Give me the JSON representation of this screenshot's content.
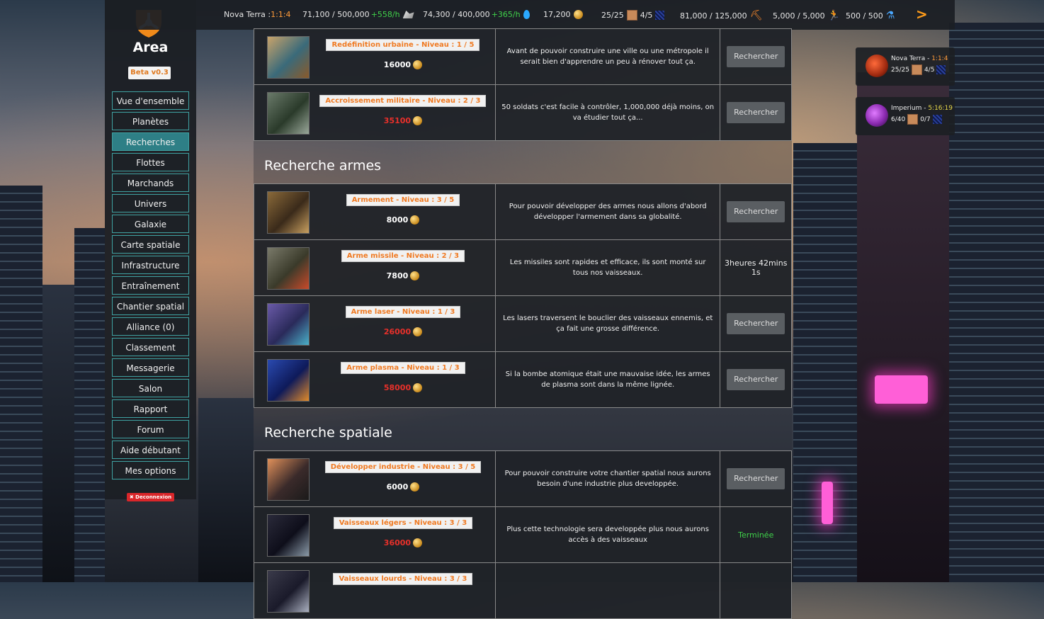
{
  "topbar": {
    "planet_name": "Nova Terra : ",
    "planet_pos": "1:1:4",
    "metal": "71,100 / 500,000",
    "metal_rate": "+558/h",
    "water": "74,300 / 400,000",
    "water_rate": "+365/h",
    "credits": "17,200",
    "fields": "25/25",
    "slots": "4/5",
    "energy": "81,000 / 125,000",
    "population": "5,000 / 5,000",
    "research_pts": "500 / 500",
    "next_label": ">"
  },
  "sidebar": {
    "logo_text": "Area",
    "version": "Beta v0.3",
    "items": [
      {
        "label": "Vue d'ensemble",
        "name": "sidebar-item-overview"
      },
      {
        "label": "Planètes",
        "name": "sidebar-item-planets"
      },
      {
        "label": "Recherches",
        "name": "sidebar-item-research"
      },
      {
        "label": "Flottes",
        "name": "sidebar-item-fleets"
      },
      {
        "label": "Marchands",
        "name": "sidebar-item-merchants"
      },
      {
        "label": "Univers",
        "name": "sidebar-item-universe"
      },
      {
        "label": "Galaxie",
        "name": "sidebar-item-galaxy"
      },
      {
        "label": "Carte spatiale",
        "name": "sidebar-item-space-map"
      },
      {
        "label": "Infrastructure",
        "name": "sidebar-item-infrastructure"
      },
      {
        "label": "Entraînement",
        "name": "sidebar-item-training"
      },
      {
        "label": "Chantier spatial",
        "name": "sidebar-item-shipyard"
      },
      {
        "label": "Alliance (0)",
        "name": "sidebar-item-alliance"
      },
      {
        "label": "Classement",
        "name": "sidebar-item-ranking"
      },
      {
        "label": "Messagerie",
        "name": "sidebar-item-messages"
      },
      {
        "label": "Salon",
        "name": "sidebar-item-chat"
      },
      {
        "label": "Rapport",
        "name": "sidebar-item-reports"
      },
      {
        "label": "Forum",
        "name": "sidebar-item-forum"
      },
      {
        "label": "Aide débutant",
        "name": "sidebar-item-help"
      },
      {
        "label": "Mes options",
        "name": "sidebar-item-options"
      }
    ],
    "active_index": 2,
    "logout_label": "✖ Deconnexion"
  },
  "planets": [
    {
      "name": "Nova Terra - ",
      "pos": "1:1:4",
      "fields": "25/25",
      "slots": "4/5"
    },
    {
      "name": "Imperium - ",
      "pos": "5:16:19",
      "fields": "6/40",
      "slots": "0/7"
    }
  ],
  "colors": {
    "accent": "#f07a22",
    "nav_border": "#3fa2a2",
    "nav_active": "#2e7f86",
    "cost_insufficient": "#e8302a",
    "done": "#3fd14a"
  },
  "sections": [
    {
      "title": "",
      "rows": [
        {
          "title": "Redéfinition urbaine - Niveau : 1 / 5",
          "cost": "16000",
          "affordable": true,
          "desc": "Avant de pouvoir construire une ville ou une métropole il serait bien d'apprendre un peu à rénover tout ça.",
          "action": "button",
          "action_label": "Rechercher",
          "thumb": [
            "#c9a36a",
            "#3a6a7a",
            "#8a5a2a"
          ]
        },
        {
          "title": "Accroissement militaire - Niveau : 2 / 3",
          "cost": "35100",
          "affordable": false,
          "desc": "50 soldats c'est facile à contrôler, 1,000,000 déjà moins, on va étudier tout ça...",
          "action": "button",
          "action_label": "Rechercher",
          "thumb": [
            "#6a7a6a",
            "#2a3a2a",
            "#9aa89a"
          ]
        }
      ]
    },
    {
      "title": "Recherche armes",
      "rows": [
        {
          "title": "Armement - Niveau : 3 / 5",
          "cost": "8000",
          "affordable": true,
          "desc": "Pour pouvoir développer des armes nous allons d'abord développer l'armement dans sa globalité.",
          "action": "button",
          "action_label": "Rechercher",
          "thumb": [
            "#8a6a3a",
            "#3a2a1a",
            "#c9a060"
          ]
        },
        {
          "title": "Arme missile - Niveau : 2 / 3",
          "cost": "7800",
          "affordable": true,
          "desc": "Les missiles sont rapides et efficace, ils sont monté sur tous nos vaisseaux.",
          "action": "text",
          "action_label": "3heures 42mins 1s",
          "thumb": [
            "#7a7a6a",
            "#3a3a2a",
            "#c94a2a"
          ]
        },
        {
          "title": "Arme laser - Niveau : 1 / 3",
          "cost": "26000",
          "affordable": false,
          "desc": "Les lasers traversent le bouclier des vaisseaux ennemis, et ça fait une grosse différence.",
          "action": "button",
          "action_label": "Rechercher",
          "thumb": [
            "#6a5aa8",
            "#2a2a5a",
            "#4ab0c9"
          ]
        },
        {
          "title": "Arme plasma - Niveau : 1 / 3",
          "cost": "58000",
          "affordable": false,
          "desc": "Si la bombe atomique était une mauvaise idée, les armes de plasma sont dans la même lignée.",
          "action": "button",
          "action_label": "Rechercher",
          "thumb": [
            "#2a4ab0",
            "#0e1a5a",
            "#e08a2a"
          ]
        }
      ]
    },
    {
      "title": "Recherche spatiale",
      "rows": [
        {
          "title": "Développer industrie - Niveau : 3 / 5",
          "cost": "6000",
          "affordable": true,
          "desc": "Pour pouvoir construire votre chantier spatial nous aurons besoin d'une industrie plus developpée.",
          "action": "button",
          "action_label": "Rechercher",
          "thumb": [
            "#e0905a",
            "#3a2a2a",
            "#1a1a1a"
          ]
        },
        {
          "title": "Vaisseaux légers - Niveau : 3 / 3",
          "cost": "36000",
          "affordable": false,
          "desc": "Plus cette technologie sera developpée plus nous aurons accès à des vaisseaux",
          "action": "done",
          "action_label": "Terminée",
          "thumb": [
            "#2a2a3a",
            "#0e0e1a",
            "#8a9aa8"
          ]
        },
        {
          "title": "Vaisseaux lourds - Niveau : 3 / 3",
          "cost": "",
          "affordable": false,
          "desc": "",
          "action": "none",
          "action_label": "",
          "thumb": [
            "#3a3a4a",
            "#1a1a2a",
            "#aab0c0"
          ]
        }
      ]
    }
  ]
}
